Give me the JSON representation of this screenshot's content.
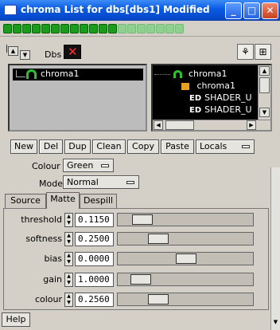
{
  "window": {
    "title": "chroma List for dbs[dbs1] Modified",
    "minimize_label": "_",
    "maximize_label": "□",
    "close_label": "✕"
  },
  "toolbar": {
    "dbs_label": "Dbs"
  },
  "left_tree": {
    "items": [
      {
        "label": "chroma1",
        "selected": true
      }
    ]
  },
  "right_tree": {
    "items": [
      {
        "label": "chroma1",
        "selected": true
      },
      {
        "label": "chroma1"
      },
      {
        "badge": "ED",
        "label": "SHADER_U"
      },
      {
        "badge": "ED",
        "label": "SHADER_U"
      }
    ]
  },
  "actions": [
    "New",
    "Del",
    "Dup",
    "Clean",
    "Copy",
    "Paste",
    "Locals"
  ],
  "colour_row": {
    "label": "Colour",
    "value": "Green"
  },
  "mode_row": {
    "label": "Mode",
    "value": "Normal"
  },
  "tabs": [
    "Source",
    "Matte",
    "Despill"
  ],
  "active_tab": "Matte",
  "params": [
    {
      "label": "threshold",
      "value": "0.1150",
      "level": 0.115
    },
    {
      "label": "softness",
      "value": "0.2500",
      "level": 0.25
    },
    {
      "label": "bias",
      "value": "0.0000",
      "level": 0.5
    },
    {
      "label": "gain",
      "value": "1.0000",
      "level": 0.1
    },
    {
      "label": "colour",
      "value": "0.2560",
      "level": 0.256
    }
  ],
  "help_label": "Help",
  "colors": {
    "accent": "#0a5ae4",
    "dot_green": "#1a9d1a",
    "selection": "#000000"
  }
}
